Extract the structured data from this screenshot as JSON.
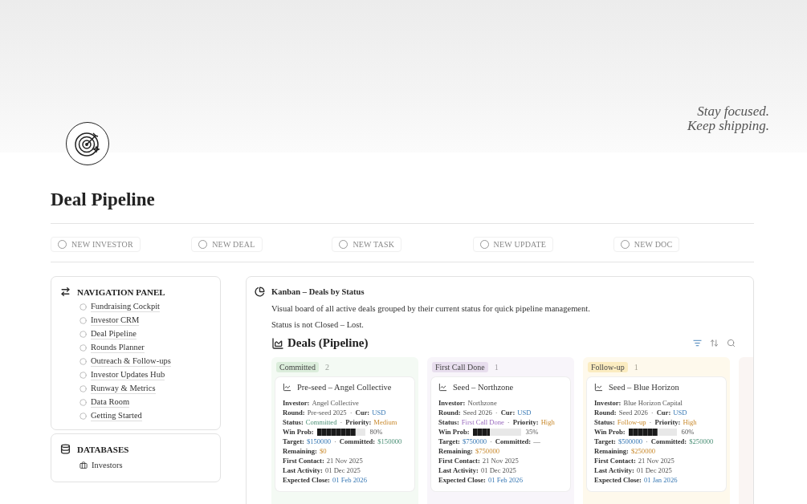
{
  "cover": {
    "quote": [
      "Stay focused.",
      "Keep shipping."
    ]
  },
  "page": {
    "title": "Deal Pipeline"
  },
  "quick_actions": [
    "NEW INVESTOR",
    "NEW DEAL",
    "NEW TASK",
    "NEW UPDATE",
    "NEW DOC"
  ],
  "navigation_panel": {
    "title": "NAVIGATION PANEL",
    "items": [
      "Fundraising Cockpit",
      "Investor CRM",
      "Deal Pipeline",
      "Rounds Planner",
      "Outreach & Follow-ups",
      "Investor Updates Hub",
      "Runway & Metrics",
      "Data Room",
      "Getting Started"
    ]
  },
  "databases_panel": {
    "title": "DATABASES",
    "items": [
      "Investors"
    ]
  },
  "kanban": {
    "title": "Kanban – Deals by Status",
    "description": "Visual board of all active deals grouped by their current status for quick pipeline management.",
    "filter": "Status is not Closed – Lost.",
    "view_title": "Deals (Pipeline)",
    "columns": [
      {
        "status": "Committed",
        "count": "2",
        "color": "#dbeddb",
        "cards": [
          {
            "title": "Pre-seed – Angel Collective",
            "lines": [
              {
                "fields": [
                  {
                    "kind": "plain",
                    "label": "Investor:",
                    "value": "Angel Collective"
                  }
                ]
              },
              {
                "separator": "·",
                "fields": [
                  {
                    "kind": "plain",
                    "label": "Round:",
                    "value": "Pre-seed 2025"
                  },
                  {
                    "kind": "link",
                    "label": "Cur:",
                    "value": "USD"
                  }
                ]
              },
              {
                "separator": "·",
                "fields": [
                  {
                    "kind": "success",
                    "label": "Status:",
                    "value": "Committed"
                  },
                  {
                    "kind": "warning",
                    "label": "Priority:",
                    "value": "Medium"
                  }
                ]
              },
              {
                "fields": [
                  {
                    "kind": "meter",
                    "label": "Win Prob:",
                    "level": 0.8,
                    "value": "80%"
                  }
                ]
              },
              {
                "separator": "·",
                "fields": [
                  {
                    "kind": "link",
                    "label": "Target:",
                    "value": "$150000"
                  },
                  {
                    "kind": "success",
                    "label": "Committed:",
                    "value": "$150000"
                  }
                ]
              },
              {
                "fields": [
                  {
                    "kind": "warning",
                    "label": "Remaining:",
                    "value": "$0"
                  }
                ]
              },
              {
                "fields": [
                  {
                    "kind": "plain",
                    "label": "First Contact:",
                    "value": "21 Nov 2025"
                  }
                ]
              },
              {
                "fields": [
                  {
                    "kind": "plain",
                    "label": "Last Activity:",
                    "value": "01 Dec 2025"
                  }
                ]
              },
              {
                "fields": [
                  {
                    "kind": "link",
                    "label": "Expected Close:",
                    "value": "01 Feb 2026"
                  }
                ]
              }
            ]
          }
        ]
      },
      {
        "status": "First Call Done",
        "count": "1",
        "color": "#e8deee",
        "cards": [
          {
            "title": "Seed – Northzone",
            "lines": [
              {
                "fields": [
                  {
                    "kind": "plain",
                    "label": "Investor:",
                    "value": "Northzone"
                  }
                ]
              },
              {
                "separator": "·",
                "fields": [
                  {
                    "kind": "plain",
                    "label": "Round:",
                    "value": "Seed 2026"
                  },
                  {
                    "kind": "link",
                    "label": "Cur:",
                    "value": "USD"
                  }
                ]
              },
              {
                "separator": "·",
                "fields": [
                  {
                    "kind": "accent",
                    "label": "Status:",
                    "value": "First Call Done"
                  },
                  {
                    "kind": "warning",
                    "label": "Priority:",
                    "value": "High"
                  }
                ]
              },
              {
                "fields": [
                  {
                    "kind": "meter",
                    "label": "Win Prob:",
                    "level": 0.35,
                    "value": "35%"
                  }
                ]
              },
              {
                "separator": "·",
                "fields": [
                  {
                    "kind": "link",
                    "label": "Target:",
                    "value": "$750000"
                  },
                  {
                    "kind": "plain",
                    "label": "Committed:",
                    "value": "—"
                  }
                ]
              },
              {
                "fields": [
                  {
                    "kind": "warning",
                    "label": "Remaining:",
                    "value": "$750000"
                  }
                ]
              },
              {
                "fields": [
                  {
                    "kind": "plain",
                    "label": "First Contact:",
                    "value": "21 Nov 2025"
                  }
                ]
              },
              {
                "fields": [
                  {
                    "kind": "plain",
                    "label": "Last Activity:",
                    "value": "01 Dec 2025"
                  }
                ]
              },
              {
                "fields": [
                  {
                    "kind": "link",
                    "label": "Expected Close:",
                    "value": "01 Feb 2026"
                  }
                ]
              }
            ]
          }
        ]
      },
      {
        "status": "Follow-up",
        "count": "1",
        "color": "#fbecc0",
        "cards": [
          {
            "title": "Seed – Blue Horizon",
            "lines": [
              {
                "fields": [
                  {
                    "kind": "plain",
                    "label": "Investor:",
                    "value": "Blue Horizon Capital"
                  }
                ]
              },
              {
                "separator": "·",
                "fields": [
                  {
                    "kind": "plain",
                    "label": "Round:",
                    "value": "Seed 2026"
                  },
                  {
                    "kind": "link",
                    "label": "Cur:",
                    "value": "USD"
                  }
                ]
              },
              {
                "separator": "·",
                "fields": [
                  {
                    "kind": "warning",
                    "label": "Status:",
                    "value": "Follow-up"
                  },
                  {
                    "kind": "warning",
                    "label": "Priority:",
                    "value": "High"
                  }
                ]
              },
              {
                "fields": [
                  {
                    "kind": "meter",
                    "label": "Win Prob:",
                    "level": 0.6,
                    "value": "60%"
                  }
                ]
              },
              {
                "separator": "·",
                "fields": [
                  {
                    "kind": "link",
                    "label": "Target:",
                    "value": "$500000"
                  },
                  {
                    "kind": "success",
                    "label": "Committed:",
                    "value": "$250000"
                  }
                ]
              },
              {
                "fields": [
                  {
                    "kind": "warning",
                    "label": "Remaining:",
                    "value": "$250000"
                  }
                ]
              },
              {
                "fields": [
                  {
                    "kind": "plain",
                    "label": "First Contact:",
                    "value": "21 Nov 2025"
                  }
                ]
              },
              {
                "fields": [
                  {
                    "kind": "plain",
                    "label": "Last Activity:",
                    "value": "01 Dec 2025"
                  }
                ]
              },
              {
                "fields": [
                  {
                    "kind": "link",
                    "label": "Expected Close:",
                    "value": "01 Jan 2026"
                  }
                ]
              }
            ]
          }
        ]
      }
    ]
  }
}
